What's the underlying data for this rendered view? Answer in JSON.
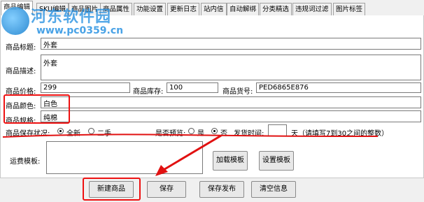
{
  "tabs": [
    "商品编辑",
    "SKU编辑",
    "商品图片",
    "商品属性",
    "功能设置",
    "更新日志",
    "站内信",
    "自动解绑",
    "分类精选",
    "违规词过滤",
    "图片标签"
  ],
  "form": {
    "title_label": "商品标题:",
    "title_value": "外套",
    "desc_label": "商品描述:",
    "desc_value": "外套",
    "price_label": "商品价格:",
    "price_value": "299",
    "stock_label": "商品库存:",
    "stock_value": "100",
    "sku_label": "商品货号:",
    "sku_value": "PED6865E876",
    "color_label": "商品颜色:",
    "color_value": "白色",
    "spec_label": "商品规格:",
    "spec_value": "纯棉",
    "condition_label": "商品保存状况:",
    "condition_new": "全新",
    "condition_used": "二手",
    "preview_label": "是否预览:",
    "preview_yes": "是",
    "preview_no": "否",
    "ship_label": "发货时间:",
    "ship_value": "",
    "ship_unit": "天（请填写7到30之间的整数）",
    "freight_label": "运费模板:",
    "load_template": "加载模板",
    "set_template": "设置模板"
  },
  "footer": {
    "new_button": "新建商品",
    "save_button": "保存",
    "save_publish_button": "保存发布",
    "clear_button": "清空信息"
  },
  "watermark": {
    "title": "河东软件园",
    "url": "www.pc0359.cn"
  },
  "colors": {
    "annotation": "#e11111",
    "watermark": "#1b8be0"
  }
}
